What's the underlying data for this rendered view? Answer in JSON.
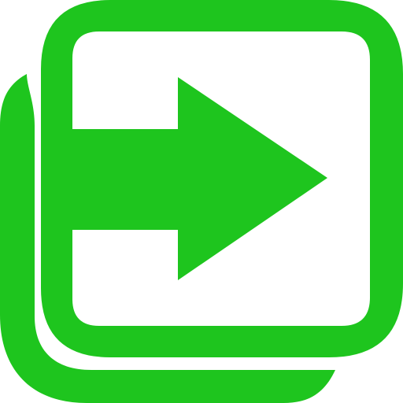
{
  "icon": {
    "name": "enter-arrow-stack-icon",
    "color": "#1ec51e",
    "background": "#ffffff"
  }
}
